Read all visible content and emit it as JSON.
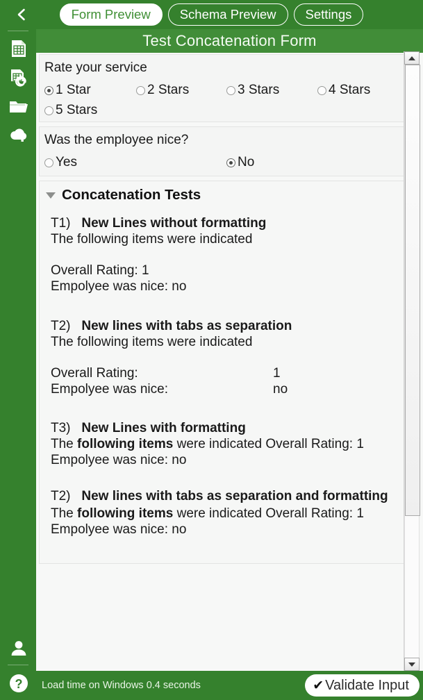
{
  "app": {
    "accent_green": "#35812d",
    "title_bar_green": "#418d38",
    "panel_bg": "#f4f5f4"
  },
  "topbar": {
    "back_icon": "chevron-left-icon",
    "tabs": [
      {
        "label": "Form Preview",
        "active": true
      },
      {
        "label": "Schema Preview",
        "active": false
      },
      {
        "label": "Settings",
        "active": false
      }
    ]
  },
  "titlebar": {
    "title": "Test Concatenation Form"
  },
  "sidebar": {
    "items": [
      {
        "icon": "spreadsheet-icon"
      },
      {
        "icon": "spreadsheet-refresh-icon"
      },
      {
        "icon": "folder-icon"
      },
      {
        "icon": "cloud-upload-icon"
      }
    ],
    "bottom_items": [
      {
        "icon": "user-icon"
      },
      {
        "icon": "help-icon"
      }
    ]
  },
  "form": {
    "rating_question": {
      "label": "Rate your service",
      "options": [
        {
          "label": "1 Star",
          "checked": true
        },
        {
          "label": "2 Stars",
          "checked": false
        },
        {
          "label": "3 Stars",
          "checked": false
        },
        {
          "label": "4 Stars",
          "checked": false
        },
        {
          "label": "5 Stars",
          "checked": false
        }
      ]
    },
    "nice_question": {
      "label": "Was the employee nice?",
      "options": [
        {
          "label": "Yes",
          "checked": false
        },
        {
          "label": "No",
          "checked": true
        }
      ]
    },
    "section": {
      "title": "Concatenation Tests",
      "expanded": true,
      "tests": [
        {
          "id": "T1)",
          "name": "New Lines without formatting",
          "line1": "The following items were indicated",
          "rating_label": "Overall Rating:",
          "rating_value": "1",
          "nice_label": "Empolyee was nice:",
          "nice_value": "no",
          "rating_line": "Overall Rating: 1",
          "nice_line": "Empolyee was nice: no"
        },
        {
          "id": "T2)",
          "name": "New lines with tabs as separation",
          "line1": "The following items were indicated",
          "rating_label": "Overall Rating:",
          "rating_value": "1",
          "nice_label": "Empolyee was nice:",
          "nice_value": "no"
        },
        {
          "id": "T3)",
          "name": "New Lines with formatting",
          "pre": "The ",
          "bold": "following items",
          "post": " were indicated Overall Rating: 1",
          "nice_line": "Empolyee was nice: no"
        },
        {
          "id": "T2)",
          "name": "New lines with tabs as separation and formatting",
          "pre": "The ",
          "bold": "following items",
          "post": " were indicated Overall Rating: 1",
          "nice_line": "Empolyee was nice: no"
        }
      ]
    }
  },
  "scrollbar": {
    "up_icon": "scroll-up-arrow-icon",
    "down_icon": "scroll-down-arrow-icon"
  },
  "statusbar": {
    "load_time": "Load time on Windows 0.4 seconds",
    "validate_icon": "check-icon",
    "validate_label": "Validate Input"
  }
}
